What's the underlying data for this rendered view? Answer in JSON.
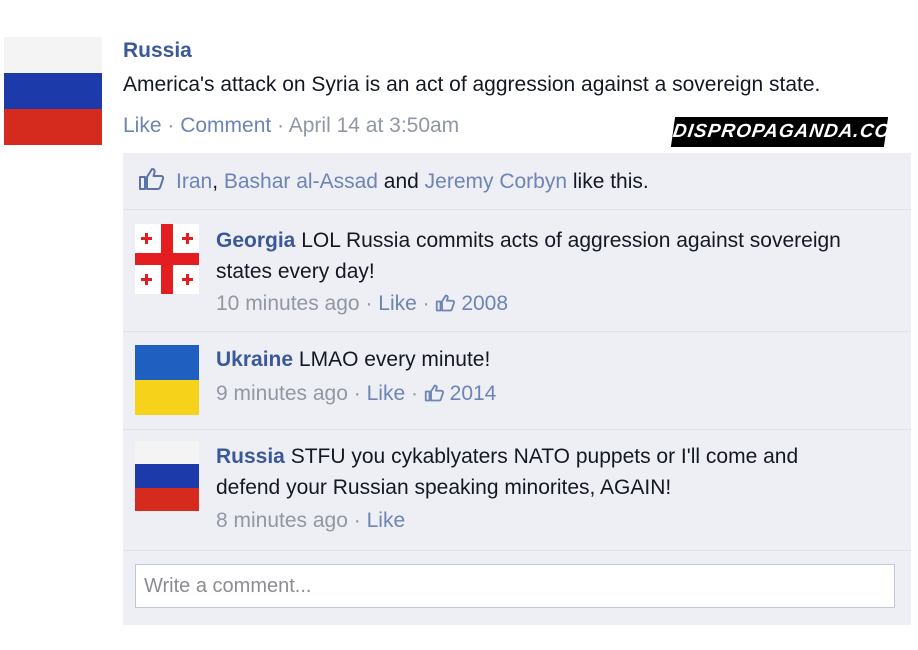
{
  "post": {
    "author": "Russia",
    "text": "America's attack on Syria is an act of aggression against a sovereign state.",
    "actions": {
      "like": "Like",
      "comment": "Comment",
      "time": "April 14 at 3:50am",
      "separator": " · "
    }
  },
  "watermark": "DISPROPAGANDA.COM",
  "likes": {
    "names": [
      "Iran",
      "Bashar al-Assad",
      "Jeremy Corbyn"
    ],
    "sep_comma": ", ",
    "sep_and": " and ",
    "suffix": " like this."
  },
  "comments": [
    {
      "author": "Georgia",
      "text": "LOL Russia commits acts of aggression against sovereign states every day!",
      "time": "10 minutes ago",
      "like_label": "Like",
      "like_count": "2008",
      "flag": "georgia"
    },
    {
      "author": "Ukraine",
      "text": "LMAO every minute!",
      "time": "9 minutes ago",
      "like_label": "Like",
      "like_count": "2014",
      "flag": "ukraine"
    },
    {
      "author": "Russia",
      "text": "STFU you cykablyaters NATO puppets or I'll come and defend your Russian speaking minorites, AGAIN!",
      "time": "8 minutes ago",
      "like_label": "Like",
      "flag": "russia"
    }
  ],
  "write_comment": {
    "placeholder": "Write a comment..."
  },
  "colors": {
    "link": "#3b5998",
    "russia": [
      "#ffffff",
      "#1c3aa9",
      "#d52b1e"
    ],
    "ukraine": [
      "#0057b7",
      "#ffd700"
    ],
    "georgia": [
      "#ffffff",
      "#ff0000"
    ]
  }
}
